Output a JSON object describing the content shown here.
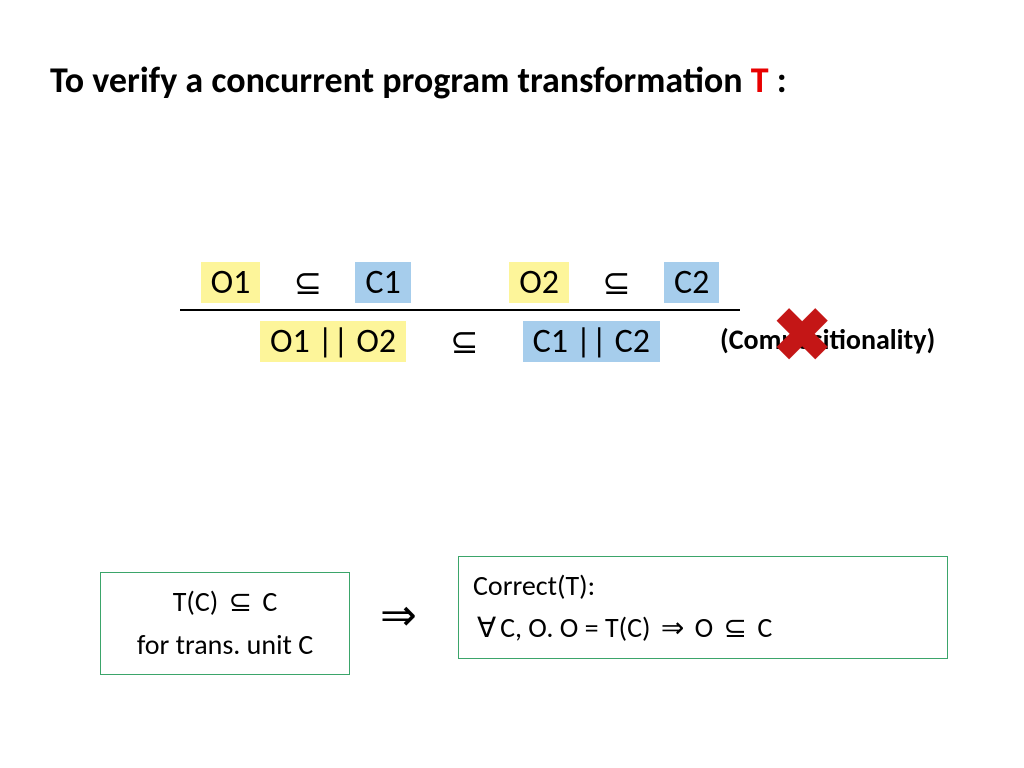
{
  "title": {
    "prefix": "To verify a concurrent program transformation ",
    "t": "T",
    "suffix": " :"
  },
  "symbols": {
    "subset": "⊆",
    "parallel": "||",
    "implies": "⇒",
    "forall": "∀"
  },
  "rule": {
    "top": {
      "o1": "O1",
      "c1": "C1",
      "o2": "O2",
      "c2": "C2"
    },
    "bottom": {
      "o1o2": "O1 || O2",
      "c1c2": "C1 || C2"
    },
    "label": "(Compositionality)"
  },
  "cross": "✖",
  "boxLeft": {
    "line1_pre": "T(C) ",
    "line1_post": " C",
    "line2": "for trans. unit C"
  },
  "boxRight": {
    "line1": "Correct(T):",
    "line2_a": "C, O.  O = T(C)  ",
    "line2_b": "  O ",
    "line2_c": " C"
  }
}
